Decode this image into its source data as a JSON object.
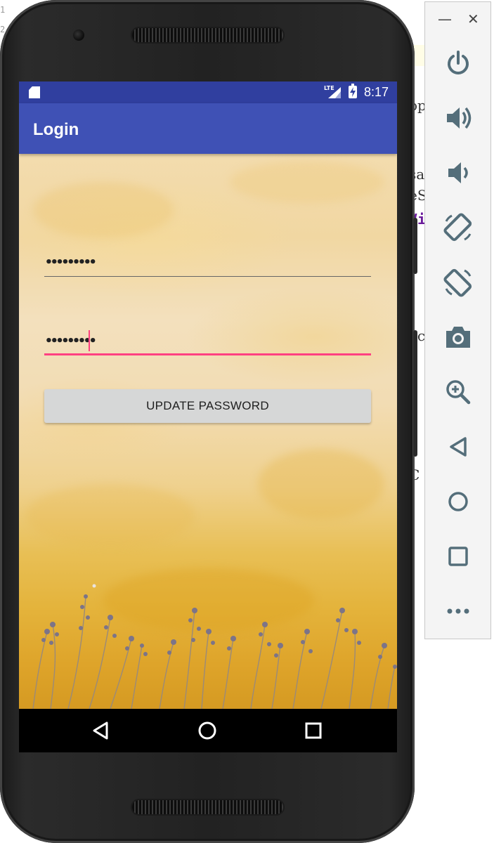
{
  "ide": {
    "gutter_numbers": [
      "1",
      "2"
    ],
    "fragments": [
      "op",
      "sa",
      "eS",
      "Vi",
      "ac",
      "C"
    ]
  },
  "status_bar": {
    "network": "LTE",
    "time": "8:17"
  },
  "app_bar": {
    "title": "Login"
  },
  "form": {
    "password_field_1": {
      "value": "•••••••••"
    },
    "password_field_2": {
      "value": "•••••••••"
    },
    "update_button_label": "UPDATE PASSWORD"
  },
  "colors": {
    "status_bar": "#303f9f",
    "app_bar": "#3f51b5",
    "accent": "#ff4081",
    "button": "#d6d7d7"
  },
  "nav_bar": {
    "icons": [
      "back-icon",
      "home-icon",
      "recents-icon"
    ]
  },
  "emulator_panel": {
    "window_controls": {
      "minimize": "—",
      "close": "✕"
    },
    "icons": [
      "power-icon",
      "volume-up-icon",
      "volume-down-icon",
      "rotate-left-icon",
      "rotate-right-icon",
      "camera-icon",
      "zoom-icon",
      "back-icon",
      "home-icon",
      "overview-icon",
      "more-icon"
    ]
  }
}
